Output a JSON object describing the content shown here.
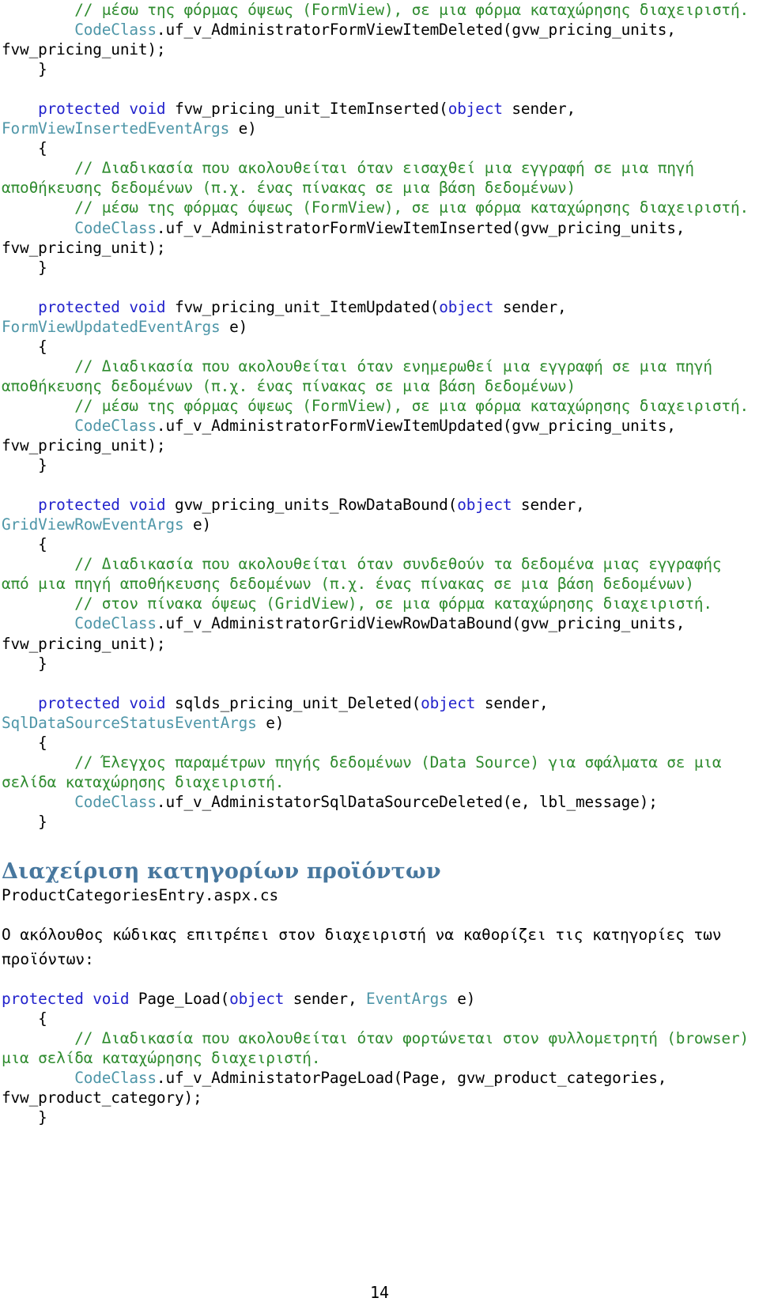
{
  "document": {
    "page_number": "14",
    "colors": {
      "comment": "#2E8B2E",
      "keyword": "#2222CC",
      "type": "#4E96A8",
      "plain": "#000000",
      "heading": "#47779E"
    }
  },
  "code_block_1": {
    "lines": [
      {
        "indent": 8,
        "segments": [
          {
            "style": "cmt",
            "text": "// μέσω της φόρμας όψεως (FormView), σε μια φόρμα καταχώρησης διαχειριστή."
          }
        ]
      },
      {
        "indent": 8,
        "segments": [
          {
            "style": "typ",
            "text": "CodeClass"
          },
          {
            "style": "pln",
            "text": ".uf_v_AdministratorFormViewItemDeleted(gvw_pricing_units, fvw_pricing_unit);"
          }
        ]
      },
      {
        "indent": 4,
        "segments": [
          {
            "style": "pln",
            "text": "}"
          }
        ]
      },
      {
        "indent": 0,
        "segments": []
      },
      {
        "indent": 4,
        "segments": [
          {
            "style": "kw",
            "text": "protected void "
          },
          {
            "style": "pln",
            "text": "fvw_pricing_unit_ItemInserted("
          },
          {
            "style": "kw",
            "text": "object"
          },
          {
            "style": "pln",
            "text": " sender, "
          },
          {
            "style": "typ",
            "text": "FormViewInsertedEventArgs"
          },
          {
            "style": "pln",
            "text": " e)"
          }
        ]
      },
      {
        "indent": 4,
        "segments": [
          {
            "style": "pln",
            "text": "{"
          }
        ]
      },
      {
        "indent": 8,
        "segments": [
          {
            "style": "cmt",
            "text": "// Διαδικασία που ακολουθείται όταν εισαχθεί μια εγγραφή σε μια πηγή αποθήκευσης δεδομένων (π.χ. ένας πίνακας σε μια βάση δεδομένων)"
          }
        ]
      },
      {
        "indent": 8,
        "segments": [
          {
            "style": "cmt",
            "text": "// μέσω της φόρμας όψεως (FormView), σε μια φόρμα καταχώρησης διαχειριστή."
          }
        ]
      },
      {
        "indent": 8,
        "segments": [
          {
            "style": "typ",
            "text": "CodeClass"
          },
          {
            "style": "pln",
            "text": ".uf_v_AdministratorFormViewItemInserted(gvw_pricing_units, fvw_pricing_unit);"
          }
        ]
      },
      {
        "indent": 4,
        "segments": [
          {
            "style": "pln",
            "text": "}"
          }
        ]
      },
      {
        "indent": 0,
        "segments": []
      },
      {
        "indent": 4,
        "segments": [
          {
            "style": "kw",
            "text": "protected void "
          },
          {
            "style": "pln",
            "text": "fvw_pricing_unit_ItemUpdated("
          },
          {
            "style": "kw",
            "text": "object"
          },
          {
            "style": "pln",
            "text": " sender, "
          },
          {
            "style": "typ",
            "text": "FormViewUpdatedEventArgs"
          },
          {
            "style": "pln",
            "text": " e)"
          }
        ]
      },
      {
        "indent": 4,
        "segments": [
          {
            "style": "pln",
            "text": "{"
          }
        ]
      },
      {
        "indent": 8,
        "segments": [
          {
            "style": "cmt",
            "text": "// Διαδικασία που ακολουθείται όταν ενημερωθεί μια εγγραφή σε μια πηγή αποθήκευσης δεδομένων (π.χ. ένας πίνακας σε μια βάση δεδομένων)"
          }
        ]
      },
      {
        "indent": 8,
        "segments": [
          {
            "style": "cmt",
            "text": "// μέσω της φόρμας όψεως (FormView), σε μια φόρμα καταχώρησης διαχειριστή."
          }
        ]
      },
      {
        "indent": 8,
        "segments": [
          {
            "style": "typ",
            "text": "CodeClass"
          },
          {
            "style": "pln",
            "text": ".uf_v_AdministratorFormViewItemUpdated(gvw_pricing_units, fvw_pricing_unit);"
          }
        ]
      },
      {
        "indent": 4,
        "segments": [
          {
            "style": "pln",
            "text": "}"
          }
        ]
      },
      {
        "indent": 0,
        "segments": []
      },
      {
        "indent": 4,
        "segments": [
          {
            "style": "kw",
            "text": "protected void "
          },
          {
            "style": "pln",
            "text": "gvw_pricing_units_RowDataBound("
          },
          {
            "style": "kw",
            "text": "object"
          },
          {
            "style": "pln",
            "text": " sender, "
          },
          {
            "style": "typ",
            "text": "GridViewRowEventArgs"
          },
          {
            "style": "pln",
            "text": " e)"
          }
        ]
      },
      {
        "indent": 4,
        "segments": [
          {
            "style": "pln",
            "text": "{"
          }
        ]
      },
      {
        "indent": 8,
        "segments": [
          {
            "style": "cmt",
            "text": "// Διαδικασία που ακολουθείται όταν συνδεθούν τα δεδομένα μιας εγγραφής από μια πηγή αποθήκευσης δεδομένων (π.χ. ένας πίνακας σε μια βάση δεδομένων)"
          }
        ]
      },
      {
        "indent": 8,
        "segments": [
          {
            "style": "cmt",
            "text": "// στον πίνακα όψεως (GridView), σε μια φόρμα καταχώρησης διαχειριστή."
          }
        ]
      },
      {
        "indent": 8,
        "segments": [
          {
            "style": "typ",
            "text": "CodeClass"
          },
          {
            "style": "pln",
            "text": ".uf_v_AdministratorGridViewRowDataBound(gvw_pricing_units, fvw_pricing_unit);"
          }
        ]
      },
      {
        "indent": 4,
        "segments": [
          {
            "style": "pln",
            "text": "}"
          }
        ]
      },
      {
        "indent": 0,
        "segments": []
      },
      {
        "indent": 4,
        "segments": [
          {
            "style": "kw",
            "text": "protected void "
          },
          {
            "style": "pln",
            "text": "sqlds_pricing_unit_Deleted("
          },
          {
            "style": "kw",
            "text": "object"
          },
          {
            "style": "pln",
            "text": " sender, "
          },
          {
            "style": "typ",
            "text": "SqlDataSourceStatusEventArgs"
          },
          {
            "style": "pln",
            "text": " e)"
          }
        ]
      },
      {
        "indent": 4,
        "segments": [
          {
            "style": "pln",
            "text": "{"
          }
        ]
      },
      {
        "indent": 8,
        "segments": [
          {
            "style": "cmt",
            "text": "// Έλεγχος παραμέτρων πηγής δεδομένων (Data Source) για σφάλματα σε μια σελίδα καταχώρησης διαχειριστή."
          }
        ]
      },
      {
        "indent": 8,
        "segments": [
          {
            "style": "typ",
            "text": "CodeClass"
          },
          {
            "style": "pln",
            "text": ".uf_v_AdministatorSqlDataSourceDeleted(e, lbl_message);"
          }
        ]
      },
      {
        "indent": 4,
        "segments": [
          {
            "style": "pln",
            "text": "}"
          }
        ]
      }
    ]
  },
  "section": {
    "heading": "Διαχείριση κατηγορίων προϊόντων",
    "filename": "ProductCategoriesEntry.aspx.cs",
    "intro": "Ο ακόλουθος κώδικας επιτρέπει στον διαχειριστή να καθορίζει τις κατηγορίες των προϊόντων:"
  },
  "code_block_2": {
    "lines": [
      {
        "indent": 0,
        "segments": [
          {
            "style": "kw",
            "text": "protected void "
          },
          {
            "style": "pln",
            "text": "Page_Load("
          },
          {
            "style": "kw",
            "text": "object"
          },
          {
            "style": "pln",
            "text": " sender, "
          },
          {
            "style": "typ",
            "text": "EventArgs"
          },
          {
            "style": "pln",
            "text": " e)"
          }
        ]
      },
      {
        "indent": 4,
        "segments": [
          {
            "style": "pln",
            "text": "{"
          }
        ]
      },
      {
        "indent": 8,
        "segments": [
          {
            "style": "cmt",
            "text": "// Διαδικασία που ακολουθείται όταν φορτώνεται στον φυλλομετρητή (browser) μια σελίδα καταχώρησης διαχειριστή."
          }
        ]
      },
      {
        "indent": 8,
        "segments": [
          {
            "style": "typ",
            "text": "CodeClass"
          },
          {
            "style": "pln",
            "text": ".uf_v_AdministatorPageLoad(Page, gvw_product_categories, fvw_product_category);"
          }
        ]
      },
      {
        "indent": 4,
        "segments": [
          {
            "style": "pln",
            "text": "}"
          }
        ]
      }
    ]
  }
}
